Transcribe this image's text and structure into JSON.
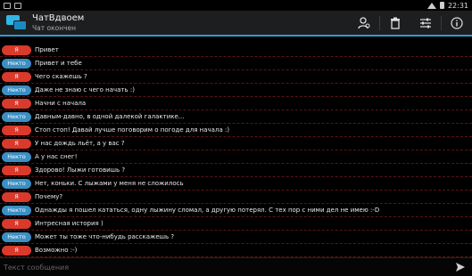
{
  "statusbar": {
    "time": "22:31"
  },
  "actionbar": {
    "title": "ЧатВдвоем",
    "subtitle": "Чат окончен"
  },
  "labels": {
    "me": "Я",
    "stranger": "Некто"
  },
  "messages": [
    {
      "author": "me",
      "badge": "Я",
      "text": "Привет"
    },
    {
      "author": "stranger",
      "badge": "Некто",
      "text": "Привет и тебе"
    },
    {
      "author": "me",
      "badge": "Я",
      "text": "Чего скажешь ?"
    },
    {
      "author": "stranger",
      "badge": "Некто",
      "text": "Даже не знаю с чего начать :)"
    },
    {
      "author": "me",
      "badge": "Я",
      "text": "Начни с начала"
    },
    {
      "author": "stranger",
      "badge": "Некто",
      "text": "Давным-давно, в одной далекой галактике..."
    },
    {
      "author": "me",
      "badge": "Я",
      "text": "Стоп стоп! Давай лучше поговорим о погоде для начала :)"
    },
    {
      "author": "me",
      "badge": "Я",
      "text": "У нас дождь льёт, а у вас ?"
    },
    {
      "author": "stranger",
      "badge": "Некто",
      "text": "А у нас снег!"
    },
    {
      "author": "me",
      "badge": "Я",
      "text": "Здорово! Лыжи готовишь ?"
    },
    {
      "author": "stranger",
      "badge": "Некто",
      "text": "Нет, коньки. С лыжами у меня не сложилось"
    },
    {
      "author": "me",
      "badge": "Я",
      "text": "Почему?"
    },
    {
      "author": "stranger",
      "badge": "Некто",
      "text": "Однажды я пошел кататься, одну лыжину сломал, а другую потерял. С тех пор с ними дел не имею :-D"
    },
    {
      "author": "me",
      "badge": "Я",
      "text": "Интресная история )"
    },
    {
      "author": "stranger",
      "badge": "Некто",
      "text": "Может ты тоже что-нибудь расскажешь ?"
    },
    {
      "author": "me",
      "badge": "Я",
      "text": "Возможно :-)"
    }
  ],
  "composer": {
    "placeholder": "Текст сообщения"
  },
  "colors": {
    "accent": "#2a9fd6",
    "me_badge": "#d93a2b",
    "stranger_badge": "#3a8fc4"
  }
}
